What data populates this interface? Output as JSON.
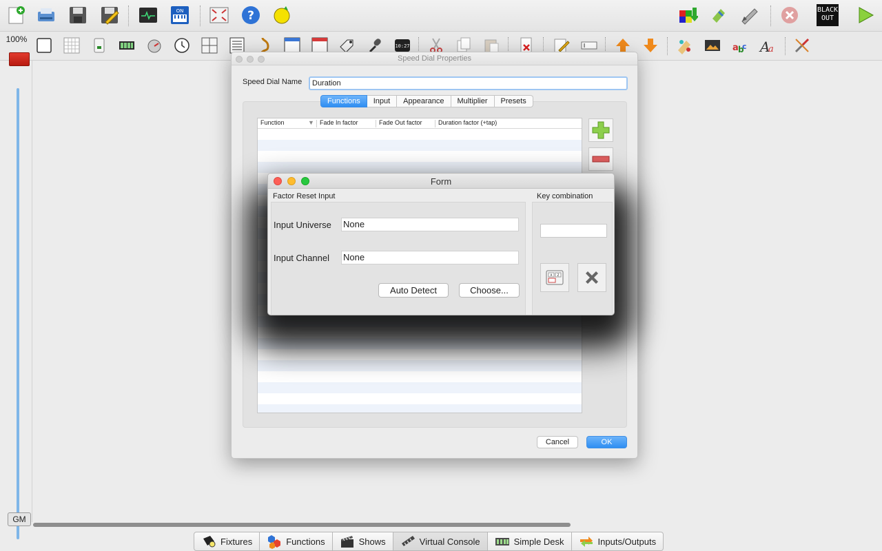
{
  "main_toolbar": {
    "blackout_label": [
      "BLACK",
      "OUT"
    ]
  },
  "gm": {
    "percent": "100%",
    "level": 1.0,
    "button": "GM"
  },
  "speed_dial": {
    "title": "Speed Dial Properties",
    "name_label": "Speed Dial Name",
    "name_value": "Duration",
    "tabs": [
      "Functions",
      "Input",
      "Appearance",
      "Multiplier",
      "Presets"
    ],
    "active_tab": "Functions",
    "table_headers": [
      "Function",
      "Fade In factor",
      "Fade Out factor",
      "Duration factor (+tap)"
    ],
    "cancel_label": "Cancel",
    "ok_label": "OK"
  },
  "form": {
    "title": "Form",
    "group_title": "Factor Reset Input",
    "universe_label": "Input Universe",
    "universe_value": "None",
    "channel_label": "Input Channel",
    "channel_value": "None",
    "auto_detect_label": "Auto Detect",
    "choose_label": "Choose...",
    "key_group_title": "Key combination",
    "key_value": ""
  },
  "bottom_tabs": [
    {
      "label": "Fixtures",
      "icon": "fixture-icon"
    },
    {
      "label": "Functions",
      "icon": "functions-icon"
    },
    {
      "label": "Shows",
      "icon": "clapperboard-icon"
    },
    {
      "label": "Virtual Console",
      "icon": "virtual-console-icon"
    },
    {
      "label": "Simple Desk",
      "icon": "simple-desk-icon"
    },
    {
      "label": "Inputs/Outputs",
      "icon": "inputs-outputs-icon"
    }
  ],
  "colors": {
    "accent": "#2f8ef2",
    "gm_handle": "#d02a1e",
    "gm_track": "#7fb6e8"
  }
}
